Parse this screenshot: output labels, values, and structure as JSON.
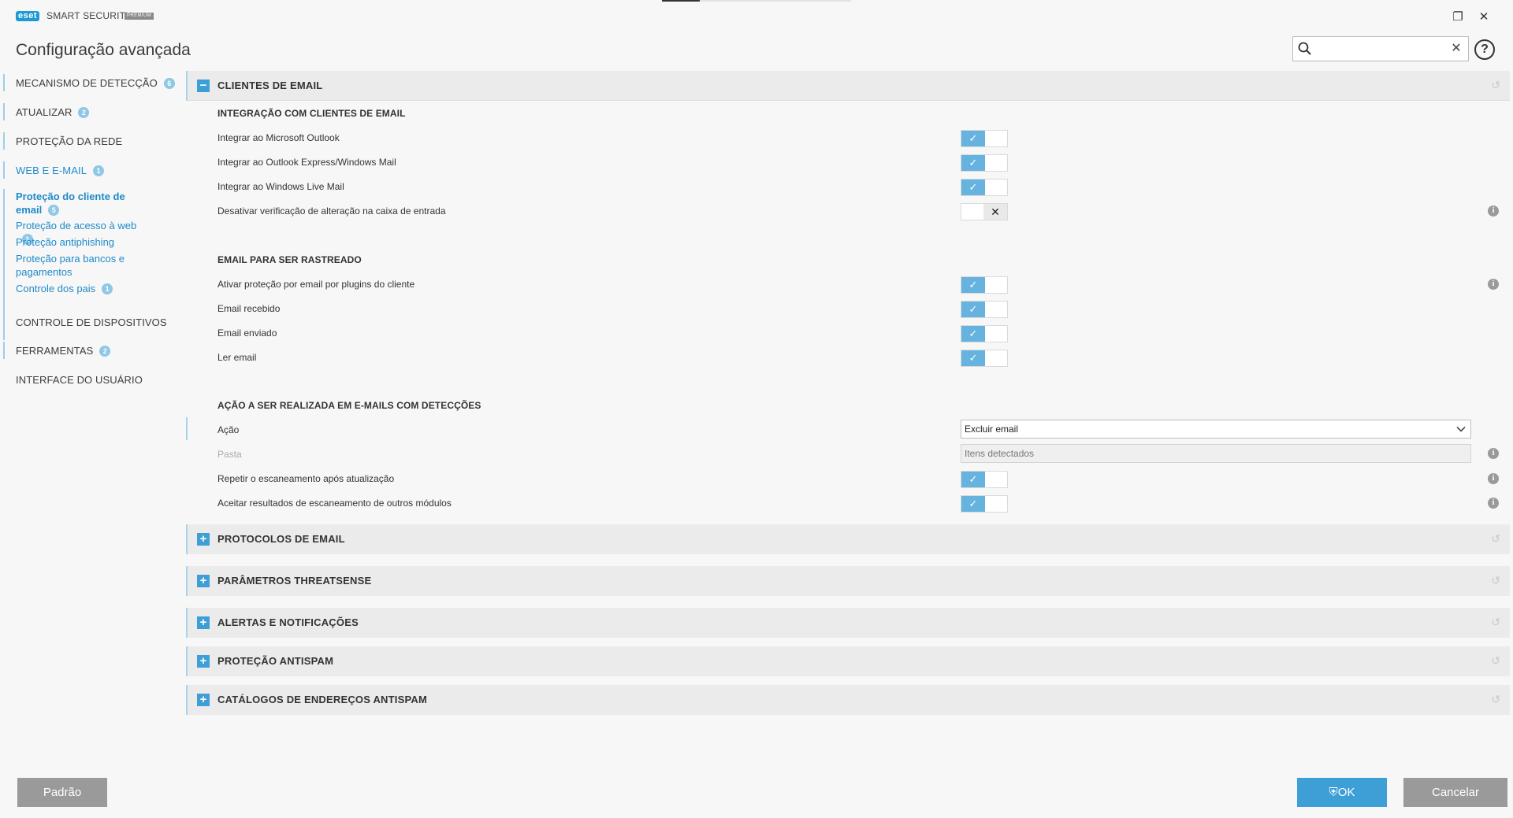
{
  "app": {
    "logo_badge": "eset",
    "product_name": "SMART SECURITY",
    "edition": "PREMIUM",
    "window_title": "Configuração avançada"
  },
  "search": {
    "placeholder": "",
    "value": ""
  },
  "sidebar": {
    "sections": [
      {
        "label": "MECANISMO DE DETECÇÃO",
        "count": "6"
      },
      {
        "label": "ATUALIZAR",
        "count": "2"
      },
      {
        "label": "PROTEÇÃO DA REDE",
        "count": ""
      },
      {
        "label": "WEB E E-MAIL",
        "count": "1"
      },
      {
        "label": "CONTROLE DE DISPOSITIVOS",
        "count": ""
      },
      {
        "label": "FERRAMENTAS",
        "count": "2"
      },
      {
        "label": "INTERFACE DO USUÁRIO",
        "count": ""
      }
    ],
    "subitems": [
      {
        "label": "Proteção do cliente de email",
        "count": "5"
      },
      {
        "label": "Proteção de acesso à web",
        "count": "1"
      },
      {
        "label": "Proteção antiphishing",
        "count": ""
      },
      {
        "label": "Proteção para bancos e pagamentos",
        "count": ""
      },
      {
        "label": "Controle dos pais",
        "count": "1"
      }
    ]
  },
  "main": {
    "expanded_section": {
      "title": "CLIENTES DE EMAIL",
      "groups": [
        {
          "title": "INTEGRAÇÃO COM CLIENTES DE EMAIL",
          "rows": [
            {
              "label": "Integrar ao Microsoft Outlook",
              "state": "on"
            },
            {
              "label": "Integrar ao Outlook Express/Windows Mail",
              "state": "on"
            },
            {
              "label": "Integrar ao Windows Live Mail",
              "state": "on"
            },
            {
              "label": "Desativar verificação de alteração na caixa de entrada",
              "state": "off"
            }
          ]
        },
        {
          "title": "EMAIL PARA SER RASTREADO",
          "rows": [
            {
              "label": "Ativar proteção por email por plugins do cliente",
              "state": "on"
            },
            {
              "label": "Email recebido",
              "state": "on"
            },
            {
              "label": "Email enviado",
              "state": "on"
            },
            {
              "label": "Ler email",
              "state": "on"
            }
          ]
        },
        {
          "title": "AÇÃO A SER REALIZADA EM E-MAILS COM DETECÇÕES",
          "rows": [
            {
              "label": "Ação",
              "control": "select",
              "value": "Excluir email"
            },
            {
              "label": "Pasta",
              "control": "textbox",
              "value": "Itens detectados",
              "disabled": true
            },
            {
              "label": "Repetir o escaneamento após atualização",
              "state": "on"
            },
            {
              "label": "Aceitar resultados de escaneamento de outros módulos",
              "state": "on"
            }
          ]
        }
      ]
    },
    "collapsed_sections": [
      "PROTOCOLOS DE EMAIL",
      "PARÂMETROS THREATSENSE",
      "ALERTAS E NOTIFICAÇÕES",
      "PROTEÇÃO ANTISPAM",
      "CATÁLOGOS DE ENDEREÇOS ANTISPAM"
    ]
  },
  "footer": {
    "default_label": "Padrão",
    "ok_label": "OK",
    "cancel_label": "Cancelar"
  },
  "icons": {
    "toggle_on": "check-icon",
    "toggle_off": "x-icon",
    "info": "info-icon",
    "revert": "revert-icon",
    "expand": "plus-icon",
    "collapse": "minus-icon"
  },
  "colors": {
    "accent": "#3d9fd6",
    "toggle_on": "#67b3e0",
    "sidebar_active": "#1f8ac9",
    "button_gray": "#9a9a9a"
  }
}
